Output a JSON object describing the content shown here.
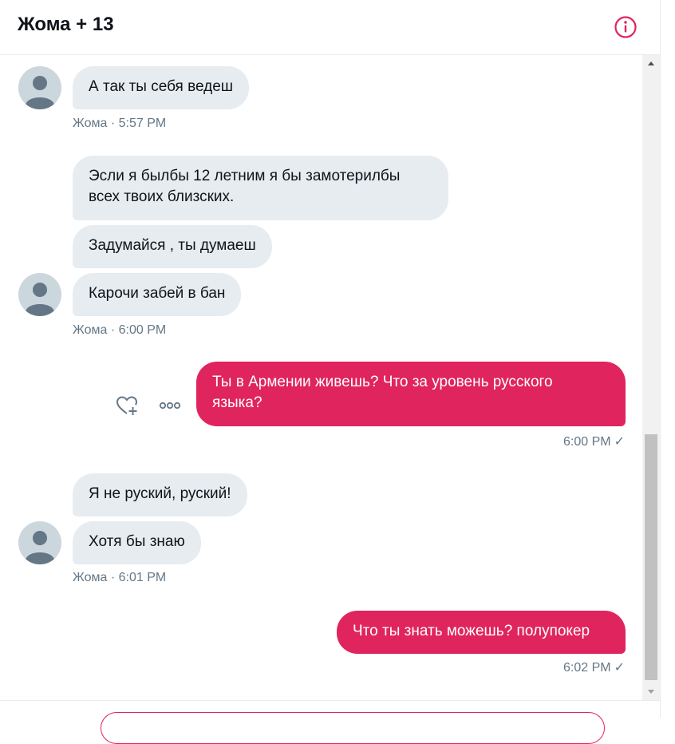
{
  "header": {
    "title": "Жома + 13",
    "info_icon": "info-circle-icon",
    "accent": "#e0245e"
  },
  "colors": {
    "incoming_bubble": "#e6ecf0",
    "outgoing_bubble": "#e0245e",
    "meta_text": "#657786"
  },
  "thread": {
    "groups": [
      {
        "direction": "incoming",
        "messages": [
          "А так ты себя ведеш"
        ],
        "meta": "Жома · 5:57 PM"
      },
      {
        "direction": "incoming",
        "messages": [
          "Эсли я былбы 12 летним я бы замотерилбы\nвсех твоих близских.",
          "Задумайся , ты думаеш",
          "Карочи забей в бан"
        ],
        "meta": "Жома · 6:00 PM"
      },
      {
        "direction": "outgoing",
        "messages": [
          "Ты в Армении живешь? Что за уровень русского\nязыка?"
        ],
        "meta": "6:00 PM",
        "status": "✓",
        "actions": [
          "heart-plus-icon",
          "more-icon"
        ]
      },
      {
        "direction": "incoming",
        "messages": [
          "Я не руский, руский!",
          "Хотя бы знаю"
        ],
        "meta": "Жома · 6:01 PM"
      },
      {
        "direction": "outgoing",
        "messages": [
          "Что ты знать можешь? полупокер"
        ],
        "meta": "6:02 PM",
        "status": "✓"
      }
    ]
  }
}
